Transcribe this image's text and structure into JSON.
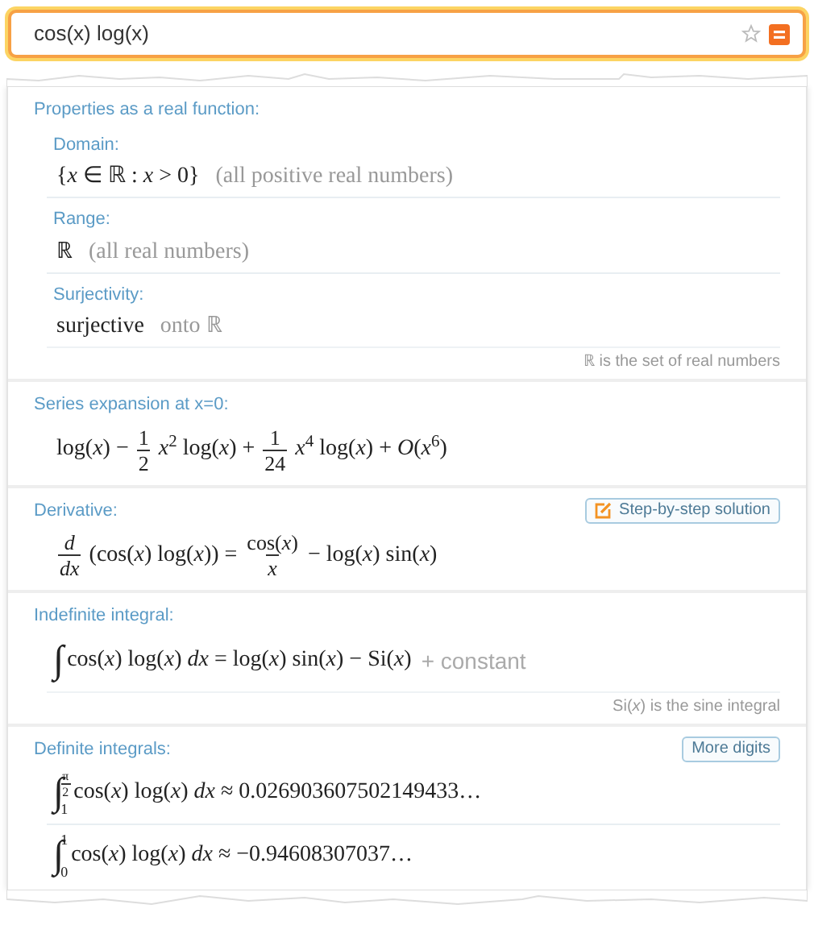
{
  "search": {
    "value": "cos(x) log(x)"
  },
  "pods": [
    {
      "title": "Properties as a real function:",
      "subpods": [
        {
          "title": "Domain:",
          "lines": [
            [
              {
                "kind": "text",
                "text": "{*x* ∈ ℝ : *x* > 0}"
              },
              {
                "kind": "muted",
                "text": "(all positive real numbers)"
              }
            ]
          ]
        },
        {
          "title": "Range:",
          "lines": [
            [
              {
                "kind": "text",
                "text": "ℝ"
              },
              {
                "kind": "muted",
                "text": "(all real numbers)"
              }
            ]
          ]
        },
        {
          "title": "Surjectivity:",
          "lines": [
            [
              {
                "kind": "text",
                "text": "surjective"
              },
              {
                "kind": "muted",
                "text": "onto ℝ"
              }
            ]
          ]
        }
      ],
      "footnote": "ℝ is the set of real numbers"
    },
    {
      "title": "Series expansion at x=0:",
      "subpods": [
        {
          "lines": [
            [
              {
                "kind": "text",
                "text": "log(*x*) −"
              },
              {
                "kind": "frac",
                "num": "1",
                "den": "2"
              },
              {
                "kind": "text",
                "text": "*x*$^{2}$ log(*x*) +"
              },
              {
                "kind": "frac",
                "num": "1",
                "den": "24"
              },
              {
                "kind": "text",
                "text": "*x*$^{4}$ log(*x*) + *O*(*x*$^{6}$)"
              }
            ]
          ]
        }
      ]
    },
    {
      "title": "Derivative:",
      "button": {
        "label": "Step-by-step solution",
        "kind": "with_icon"
      },
      "subpods": [
        {
          "lines": [
            [
              {
                "kind": "frac",
                "num": "*d*",
                "den": "*dx*"
              },
              {
                "kind": "text",
                "text": "(cos(*x*) log(*x*)) ="
              },
              {
                "kind": "frac",
                "num": "cos(*x*)",
                "den": "*x*"
              },
              {
                "kind": "text",
                "text": "− log(*x*) sin(*x*)"
              }
            ]
          ]
        }
      ]
    },
    {
      "title": "Indefinite integral:",
      "subpods": [
        {
          "lines": [
            [
              {
                "kind": "int",
                "sign": "∫"
              },
              {
                "kind": "text",
                "text": "cos(*x*) log(*x*) *dx* = log(*x*) sin(*x*) − Si(*x*)"
              },
              {
                "kind": "muted_sans",
                "text": "+ constant"
              }
            ]
          ]
        }
      ],
      "footnote": "Si(*x*) is the sine integral"
    },
    {
      "title": "Definite integrals:",
      "button": {
        "label": "More digits",
        "kind": "plain"
      },
      "subpods": [
        {
          "lines": [
            [
              {
                "kind": "int",
                "sign": "∫",
                "upper": {
                  "num": "π",
                  "den": "2"
                },
                "lower": "1"
              },
              {
                "kind": "text",
                "text": "cos(*x*) log(*x*) *dx* ≈ 0.026903607502149433…"
              }
            ],
            [
              {
                "kind": "int",
                "sign": "∫",
                "upper": "1",
                "lower": "0"
              },
              {
                "kind": "text",
                "text": "cos(*x*) log(*x*) *dx* ≈ −0.94608307037…"
              }
            ]
          ]
        }
      ]
    }
  ]
}
